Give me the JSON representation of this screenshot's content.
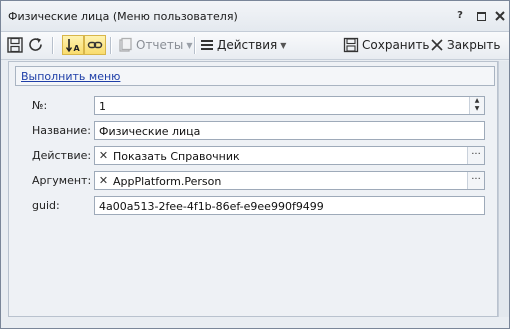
{
  "window": {
    "title": "Физические лица (Меню пользователя)",
    "help_glyph": "?"
  },
  "toolbar": {
    "reports_label": "Отчеты",
    "actions_label": "Действия",
    "save_label": "Сохранить",
    "close_label": "Закрыть"
  },
  "menu": {
    "run_link": "Выполнить меню"
  },
  "form": {
    "number": {
      "label": "№:",
      "value": "1"
    },
    "name": {
      "label": "Название:",
      "value": "Физические лица"
    },
    "action": {
      "label": "Действие:",
      "value": "Показать Справочник"
    },
    "argument": {
      "label": "Аргумент:",
      "value": "AppPlatform.Person"
    },
    "guid": {
      "label": "guid:",
      "value": "4a00a513-2fee-4f1b-86ef-e9ee990f9499"
    }
  },
  "colors": {
    "accent_link": "#1f3fa8",
    "toggle_highlight": "#f9dc6d"
  }
}
